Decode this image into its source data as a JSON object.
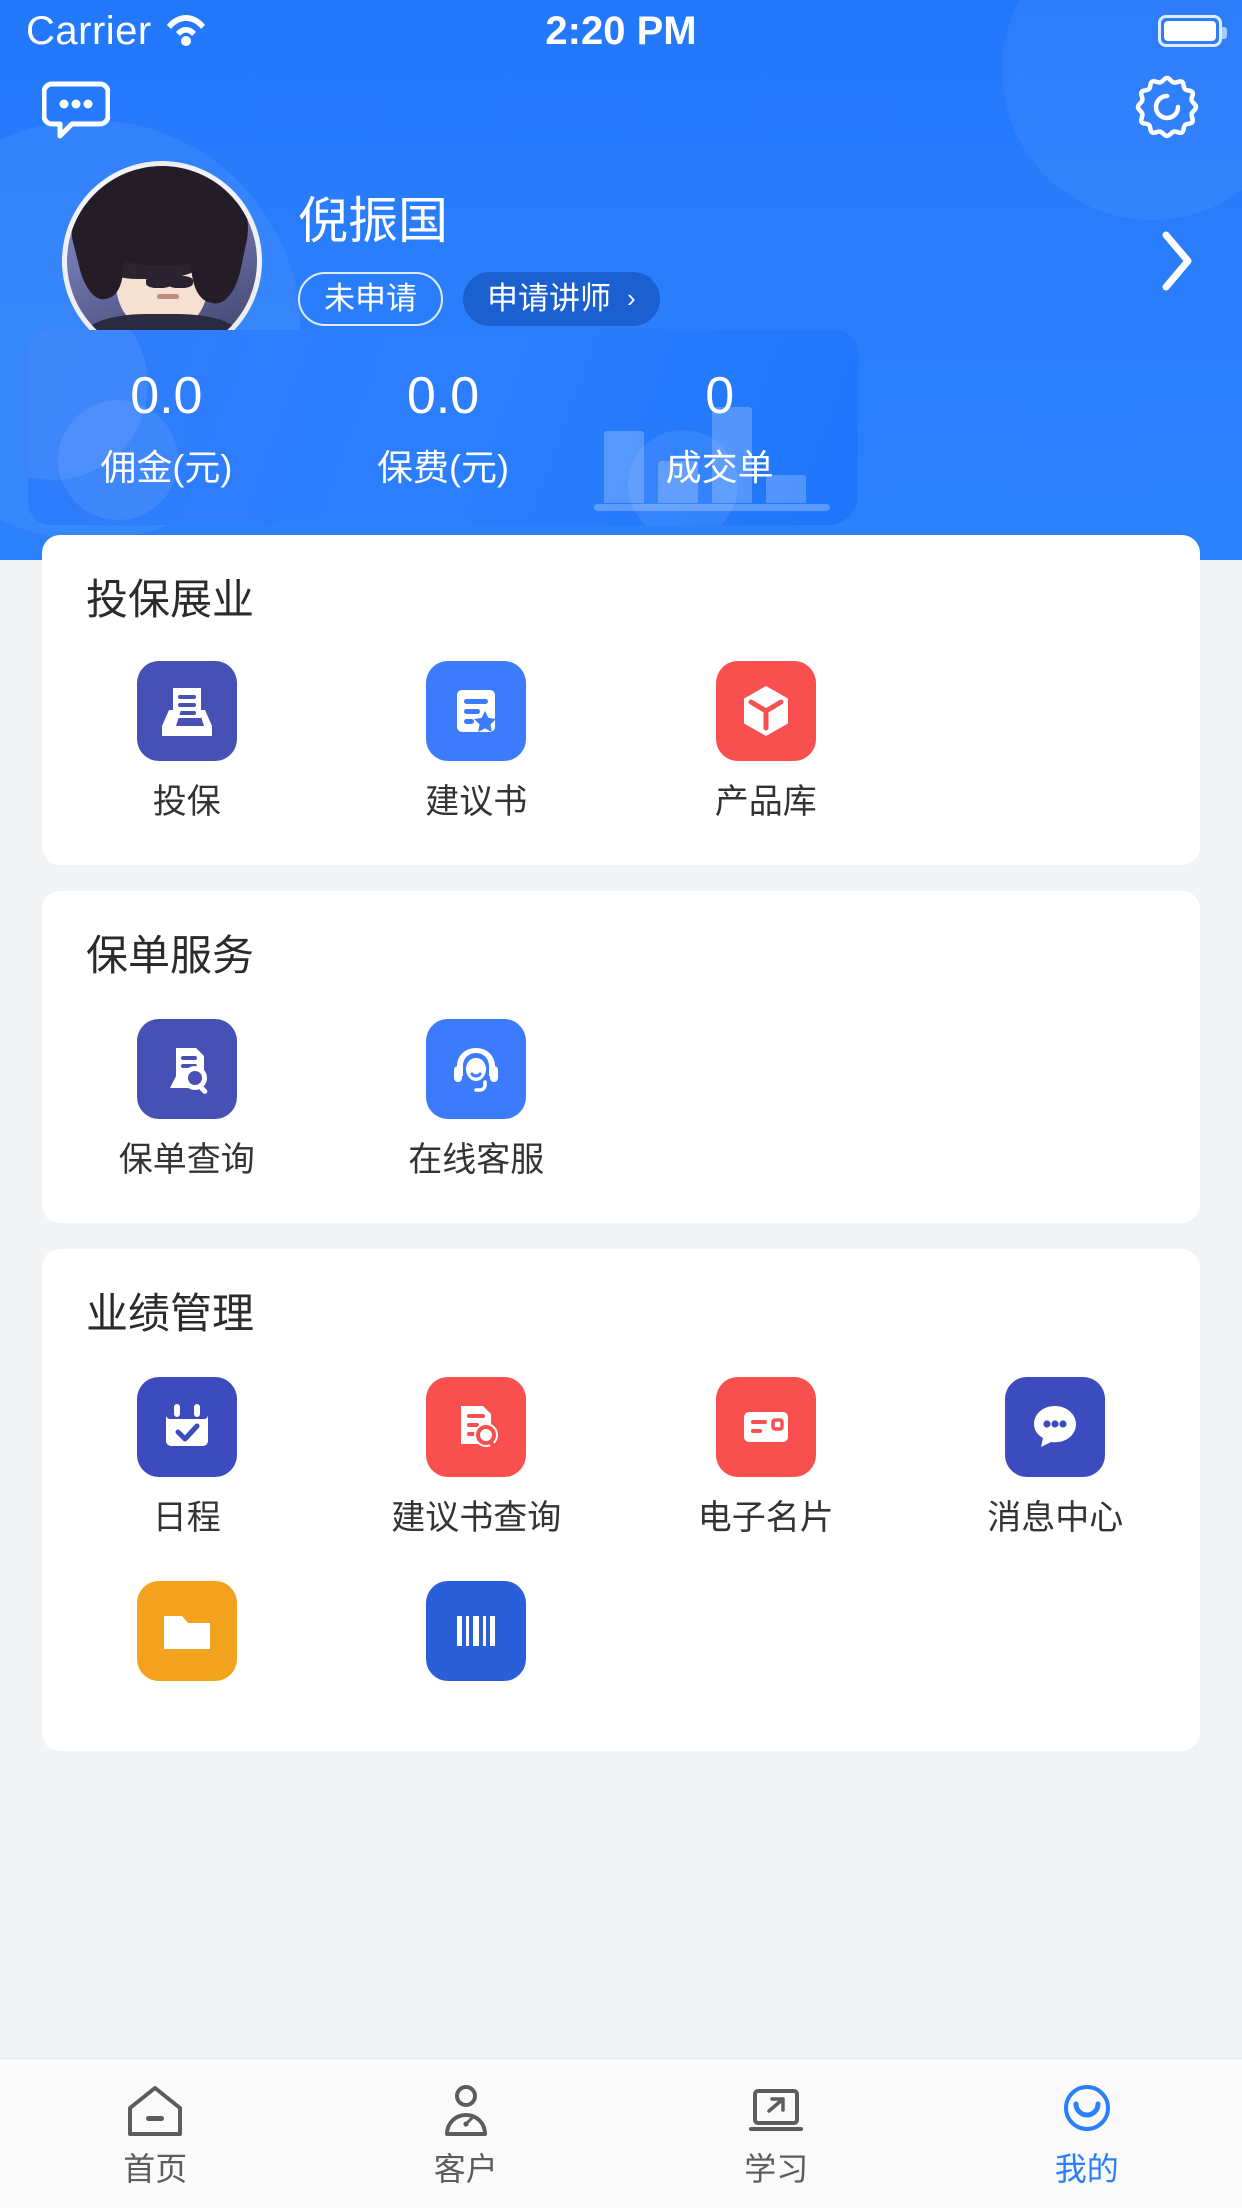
{
  "status_bar": {
    "carrier": "Carrier",
    "time": "2:20 PM",
    "wifi_icon": "wifi-icon",
    "battery_icon": "battery-icon"
  },
  "top_bar": {
    "message_icon": "chat-bubble-icon",
    "settings_icon": "gear-icon"
  },
  "profile": {
    "name": "倪振国",
    "status_badge": "未申请",
    "apply_button": "申请讲师",
    "apply_chevron": "›",
    "detail_chevron": "›",
    "avatar_alt": "user-avatar"
  },
  "stats": [
    {
      "value": "0.0",
      "label": "佣金(元)"
    },
    {
      "value": "0.0",
      "label": "保费(元)"
    },
    {
      "value": "0",
      "label": "成交单"
    }
  ],
  "sections": [
    {
      "title": "投保展业",
      "items": [
        {
          "label": "投保",
          "icon": "inbox-tray-icon",
          "color": "#4650b5"
        },
        {
          "label": "建议书",
          "icon": "document-star-icon",
          "color": "#3b7bfc"
        },
        {
          "label": "产品库",
          "icon": "hexagon-cube-icon",
          "color": "#f7504e"
        }
      ]
    },
    {
      "title": "保单服务",
      "items": [
        {
          "label": "保单查询",
          "icon": "document-search-icon",
          "color": "#4650b5"
        },
        {
          "label": "在线客服",
          "icon": "headset-support-icon",
          "color": "#3b7bfc"
        }
      ]
    },
    {
      "title": "业绩管理",
      "items": [
        {
          "label": "日程",
          "icon": "calendar-check-icon",
          "color": "#3c4bbd"
        },
        {
          "label": "建议书查询",
          "icon": "document-search-red-icon",
          "color": "#f7504e"
        },
        {
          "label": "电子名片",
          "icon": "id-card-icon",
          "color": "#f7504e"
        },
        {
          "label": "消息中心",
          "icon": "chat-dots-icon",
          "color": "#3c4bbd"
        },
        {
          "label": "",
          "icon": "folder-icon",
          "color": "#f2a21c"
        },
        {
          "label": "",
          "icon": "barcode-icon",
          "color": "#2b5fd9"
        }
      ]
    }
  ],
  "tabbar": {
    "items": [
      {
        "label": "首页",
        "icon": "home-icon",
        "active": false
      },
      {
        "label": "客户",
        "icon": "customer-icon",
        "active": false
      },
      {
        "label": "学习",
        "icon": "study-icon",
        "active": false
      },
      {
        "label": "我的",
        "icon": "profile-icon",
        "active": true
      }
    ],
    "active_color": "#2b7efc",
    "inactive_color": "#5c5c5c"
  }
}
